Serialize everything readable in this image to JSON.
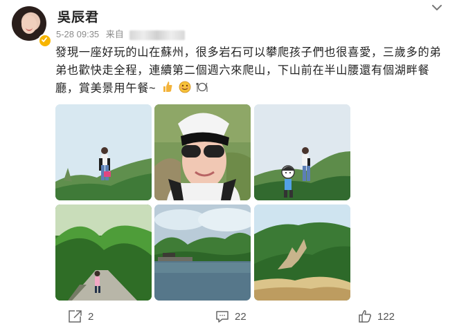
{
  "post": {
    "author": "吳辰君",
    "time": "5-28 09:35",
    "source_label": "来自",
    "text": "發現一座好玩的山在蘇州，很多岩石可以攀爬孩子們也很喜愛，三歲多的弟弟也歡快走全程，連續第二個週六來爬山，下山前在半山腰還有個湖畔餐廳，賞美景用午餐~",
    "emojis": [
      "thumbs-up-emoji",
      "smile-emoji",
      "restaurant-emoji"
    ]
  },
  "photos": [
    {
      "label": "hiking-photo-1"
    },
    {
      "label": "selfie-photo"
    },
    {
      "label": "hiking-photo-2"
    },
    {
      "label": "forest-path-photo"
    },
    {
      "label": "lake-photo"
    },
    {
      "label": "mountain-photo"
    }
  ],
  "actions": {
    "share_count": "2",
    "comment_count": "22",
    "like_count": "122"
  },
  "colors": {
    "accent": "#f7b500",
    "text": "#222222",
    "muted": "#8b8b8b"
  }
}
